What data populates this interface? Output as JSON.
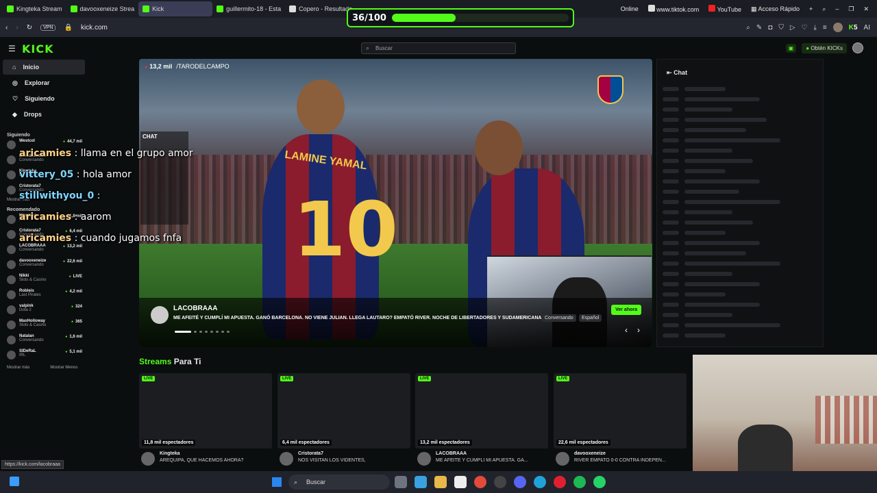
{
  "browser": {
    "tabs": [
      {
        "label": "Kingteka Stream",
        "active": false,
        "icon": "kick-favicon"
      },
      {
        "label": "davooxeneize Strea",
        "active": false,
        "icon": "kick-favicon"
      },
      {
        "label": "Kick",
        "active": true,
        "icon": "kick-favicon"
      },
      {
        "label": "guillermito-18 - Esta",
        "active": false,
        "icon": "kick-favicon"
      },
      {
        "label": "Copero - Resultado",
        "active": false,
        "icon": "generic-favicon"
      }
    ],
    "right_tabs": [
      {
        "label": "Online",
        "icon": "generic-favicon"
      },
      {
        "label": "www.tiktok.com",
        "icon": "tiktok-favicon"
      },
      {
        "label": "YouTube",
        "icon": "youtube-favicon"
      },
      {
        "label": "Acceso Rápido",
        "icon": "grid-icon"
      }
    ],
    "url": "kick.com",
    "vpn_label": "VPN",
    "kick_badge_count": "5",
    "ai_label": "AI"
  },
  "progress": {
    "label": "36/100",
    "value": 36,
    "max": 100,
    "color": "#53fc18"
  },
  "kick_header": {
    "logo": "KICK",
    "search_placeholder": "Buscar",
    "get_kicks": "Obtén KICKs"
  },
  "sidebar": {
    "nav": [
      {
        "label": "Inicio",
        "icon": "home-icon",
        "active": true
      },
      {
        "label": "Explorar",
        "icon": "compass-icon",
        "active": false
      },
      {
        "label": "Siguiendo",
        "icon": "heart-icon",
        "active": false
      },
      {
        "label": "Drops",
        "icon": "drop-icon",
        "active": false
      }
    ],
    "following_title": "Siguiendo",
    "following": [
      {
        "name": "Westcol",
        "category": "",
        "viewers": "44,7 mil"
      },
      {
        "name": "davooxeneize",
        "category": "Conversando",
        "viewers": ""
      },
      {
        "name": "Kingteka",
        "category": "Conversando",
        "viewers": ""
      },
      {
        "name": "Cristorata7",
        "category": "Conversando",
        "viewers": ""
      }
    ],
    "show_more": "Mostrar más",
    "recommended_title": "Recomendado",
    "recommended": [
      {
        "name": "Kingteka",
        "category": "IRL",
        "viewers": "11,8 mil"
      },
      {
        "name": "Cristorata7",
        "category": "Conversando",
        "viewers": "6,4 mil"
      },
      {
        "name": "LACOBRAAA",
        "category": "Conversando",
        "viewers": "13,2 mil"
      },
      {
        "name": "davooxeneize",
        "category": "Conversando",
        "viewers": "22,6 mil"
      },
      {
        "name": "Nikki",
        "category": "Slots & Casino",
        "viewers": "LIVE"
      },
      {
        "name": "Robleis",
        "category": "Last Pirates",
        "viewers": "4,2 mil"
      },
      {
        "name": "valpink",
        "category": "Dota 2",
        "viewers": "324"
      },
      {
        "name": "MaxHolloway",
        "category": "Slots & Casino",
        "viewers": "365"
      },
      {
        "name": "Natalan",
        "category": "Conversando",
        "viewers": "1,6 mil"
      },
      {
        "name": "SIDeRaL",
        "category": "IRL",
        "viewers": "5,1 mil"
      }
    ],
    "show_more_2": "Mostrar más",
    "show_less": "Mostrar Menos"
  },
  "chat_overlay": [
    {
      "user": "aricamies",
      "text": " : llama en el grupo amor"
    },
    {
      "user": "vittery_05",
      "text": " : hola amor"
    },
    {
      "user": "stillwithyou_0",
      "text": " :"
    },
    {
      "user": "aricamies",
      "text": " : aarom"
    },
    {
      "user": "aricamies",
      "text": " : cuando jugamos fnfa"
    }
  ],
  "hero": {
    "viewers": "13,2 mil",
    "watermark": "/TARODELCAMPO",
    "small_chat_label": "CHAT",
    "jersey_name": "LAMINE YAMAL",
    "jersey_number": "10",
    "featured_name": "LACOBRAAA",
    "featured_title": "ME AFEITÉ Y CUMPLÍ MI APUESTA. GANÓ BARCELONA. NO VIENE JULIAN. LLEGA LAUTARO? EMPATÓ RIVER. NOCHE DE LIBERTADORES Y SUDAMERICANA.",
    "tags": [
      "Conversando",
      "Español"
    ],
    "watch_button": "Ver ahora",
    "slides": 8,
    "current_slide": 1
  },
  "chat_panel": {
    "title": "Chat"
  },
  "streams_section": {
    "title_green": "Streams",
    "title_rest": " Para Ti"
  },
  "stream_cards": [
    {
      "live": "LIVE",
      "viewers": "11,8 mil espectadores",
      "channel": "Kingteka",
      "title": "AREQUIPA, QUÉ HACEMOS AHORA?"
    },
    {
      "live": "LIVE",
      "viewers": "6,4 mil espectadores",
      "channel": "Cristorata7",
      "title": "NOS VISITAN LOS VIDENTES,"
    },
    {
      "live": "LIVE",
      "viewers": "13,2 mil espectadores",
      "channel": "LACOBRAAA",
      "title": "ME AFEITÉ Y CUMPLÍ MI APUESTA. GA..."
    },
    {
      "live": "LIVE",
      "viewers": "22,6 mil espectadores",
      "channel": "davooxeneize",
      "title": "RIVER EMPATO 0-0 CONTRA INDEPEN..."
    }
  ],
  "status_url": "https://kick.com/lacobraaa",
  "taskbar": {
    "search_label": "Buscar"
  }
}
